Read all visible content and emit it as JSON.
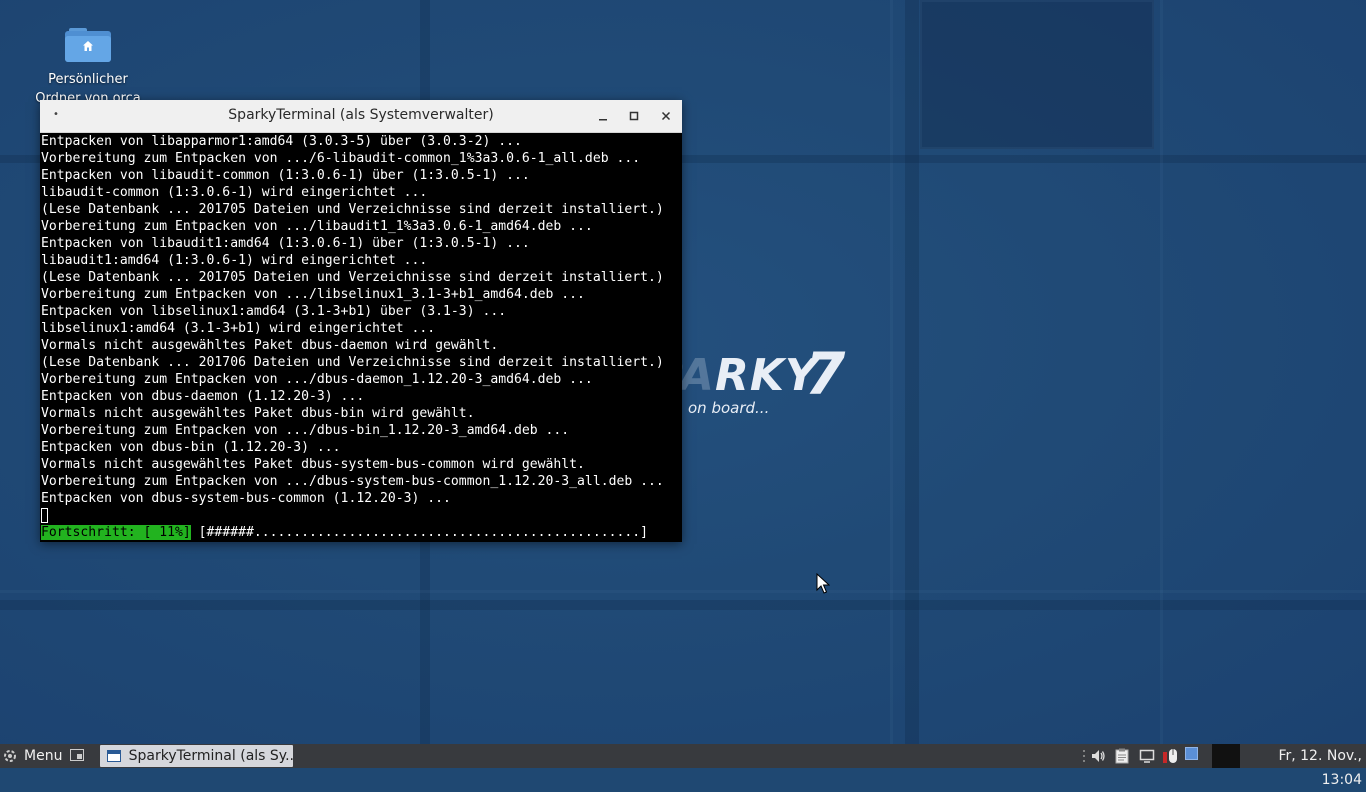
{
  "desktop": {
    "home_folder": {
      "label": "Persönlicher Ordner von orca"
    },
    "logo": {
      "word_dim": "SPA",
      "word": "RKY",
      "number": "7",
      "tagline": "on board..."
    }
  },
  "terminal": {
    "title": "SparkyTerminal (als Systemverwalter)",
    "lines": [
      "Entpacken von libapparmor1:amd64 (3.0.3-5) über (3.0.3-2) ...",
      "Vorbereitung zum Entpacken von .../6-libaudit-common_1%3a3.0.6-1_all.deb ...",
      "Entpacken von libaudit-common (1:3.0.6-1) über (1:3.0.5-1) ...",
      "libaudit-common (1:3.0.6-1) wird eingerichtet ...",
      "(Lese Datenbank ... 201705 Dateien und Verzeichnisse sind derzeit installiert.)",
      "Vorbereitung zum Entpacken von .../libaudit1_1%3a3.0.6-1_amd64.deb ...",
      "Entpacken von libaudit1:amd64 (1:3.0.6-1) über (1:3.0.5-1) ...",
      "libaudit1:amd64 (1:3.0.6-1) wird eingerichtet ...",
      "(Lese Datenbank ... 201705 Dateien und Verzeichnisse sind derzeit installiert.)",
      "Vorbereitung zum Entpacken von .../libselinux1_3.1-3+b1_amd64.deb ...",
      "Entpacken von libselinux1:amd64 (3.1-3+b1) über (3.1-3) ...",
      "libselinux1:amd64 (3.1-3+b1) wird eingerichtet ...",
      "Vormals nicht ausgewähltes Paket dbus-daemon wird gewählt.",
      "(Lese Datenbank ... 201706 Dateien und Verzeichnisse sind derzeit installiert.)",
      "Vorbereitung zum Entpacken von .../dbus-daemon_1.12.20-3_amd64.deb ...",
      "Entpacken von dbus-daemon (1.12.20-3) ...",
      "Vormals nicht ausgewähltes Paket dbus-bin wird gewählt.",
      "Vorbereitung zum Entpacken von .../dbus-bin_1.12.20-3_amd64.deb ...",
      "Entpacken von dbus-bin (1.12.20-3) ...",
      "Vormals nicht ausgewähltes Paket dbus-system-bus-common wird gewählt.",
      "Vorbereitung zum Entpacken von .../dbus-system-bus-common_1.12.20-3_all.deb ...",
      "Entpacken von dbus-system-bus-common (1.12.20-3) ..."
    ],
    "progress_label": "Fortschritt: [ 11%]",
    "progress_bar": " [######.................................................]",
    "progress_percent": 11,
    "progress_color": "#22b31f"
  },
  "taskbar": {
    "menu_label": "Menu",
    "task_label": "SparkyTerminal (als Sy...",
    "clock": "Fr, 12. Nov., 13:04",
    "icons": [
      "menu-icon",
      "show-desktop-icon",
      "terminal-icon",
      "volume-icon",
      "clipboard-icon",
      "display-icon",
      "mouse-icon"
    ]
  }
}
